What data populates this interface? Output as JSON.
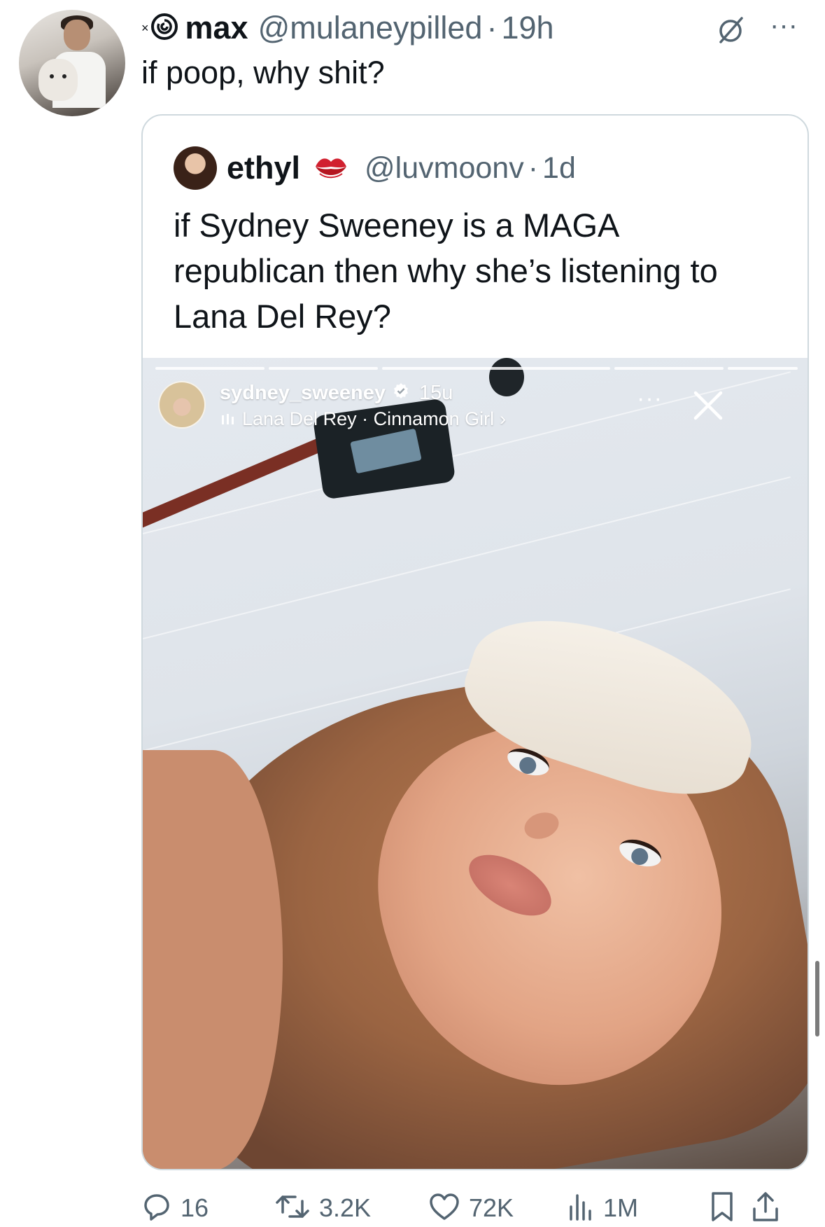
{
  "tweet": {
    "prefix_mark": "×",
    "author_name": "max",
    "author_handle": "@mulaneypilled",
    "separator": "·",
    "time": "19h",
    "text": "if poop, why shit?"
  },
  "quote": {
    "author_name": "ethyl",
    "author_handle": "@luvmoonv",
    "separator": "·",
    "time": "1d",
    "text_lines": [
      "if Sydney Sweeney is a MAGA",
      "republican then why she’s listening to",
      "Lana Del Rey?"
    ]
  },
  "story": {
    "username": "sydney_sweeney",
    "age": "15u",
    "music": "Lana Del Rey · Cinnamon Girl",
    "music_chevron": "›",
    "more": "···",
    "progress_segments": 5
  },
  "actions": {
    "replies": "16",
    "retweets": "3.2K",
    "likes": "72K",
    "views": "1M"
  },
  "colors": {
    "text_primary": "#0f1419",
    "text_secondary": "#536471",
    "border": "#cfd9de",
    "lips_red": "#d1202f"
  },
  "icons": [
    "spiral-icon",
    "grok-icon",
    "more-icon",
    "lips-emoji-icon",
    "verified-icon",
    "music-bars-icon",
    "close-icon",
    "reply-icon",
    "retweet-icon",
    "like-icon",
    "views-icon",
    "bookmark-icon",
    "share-icon"
  ]
}
